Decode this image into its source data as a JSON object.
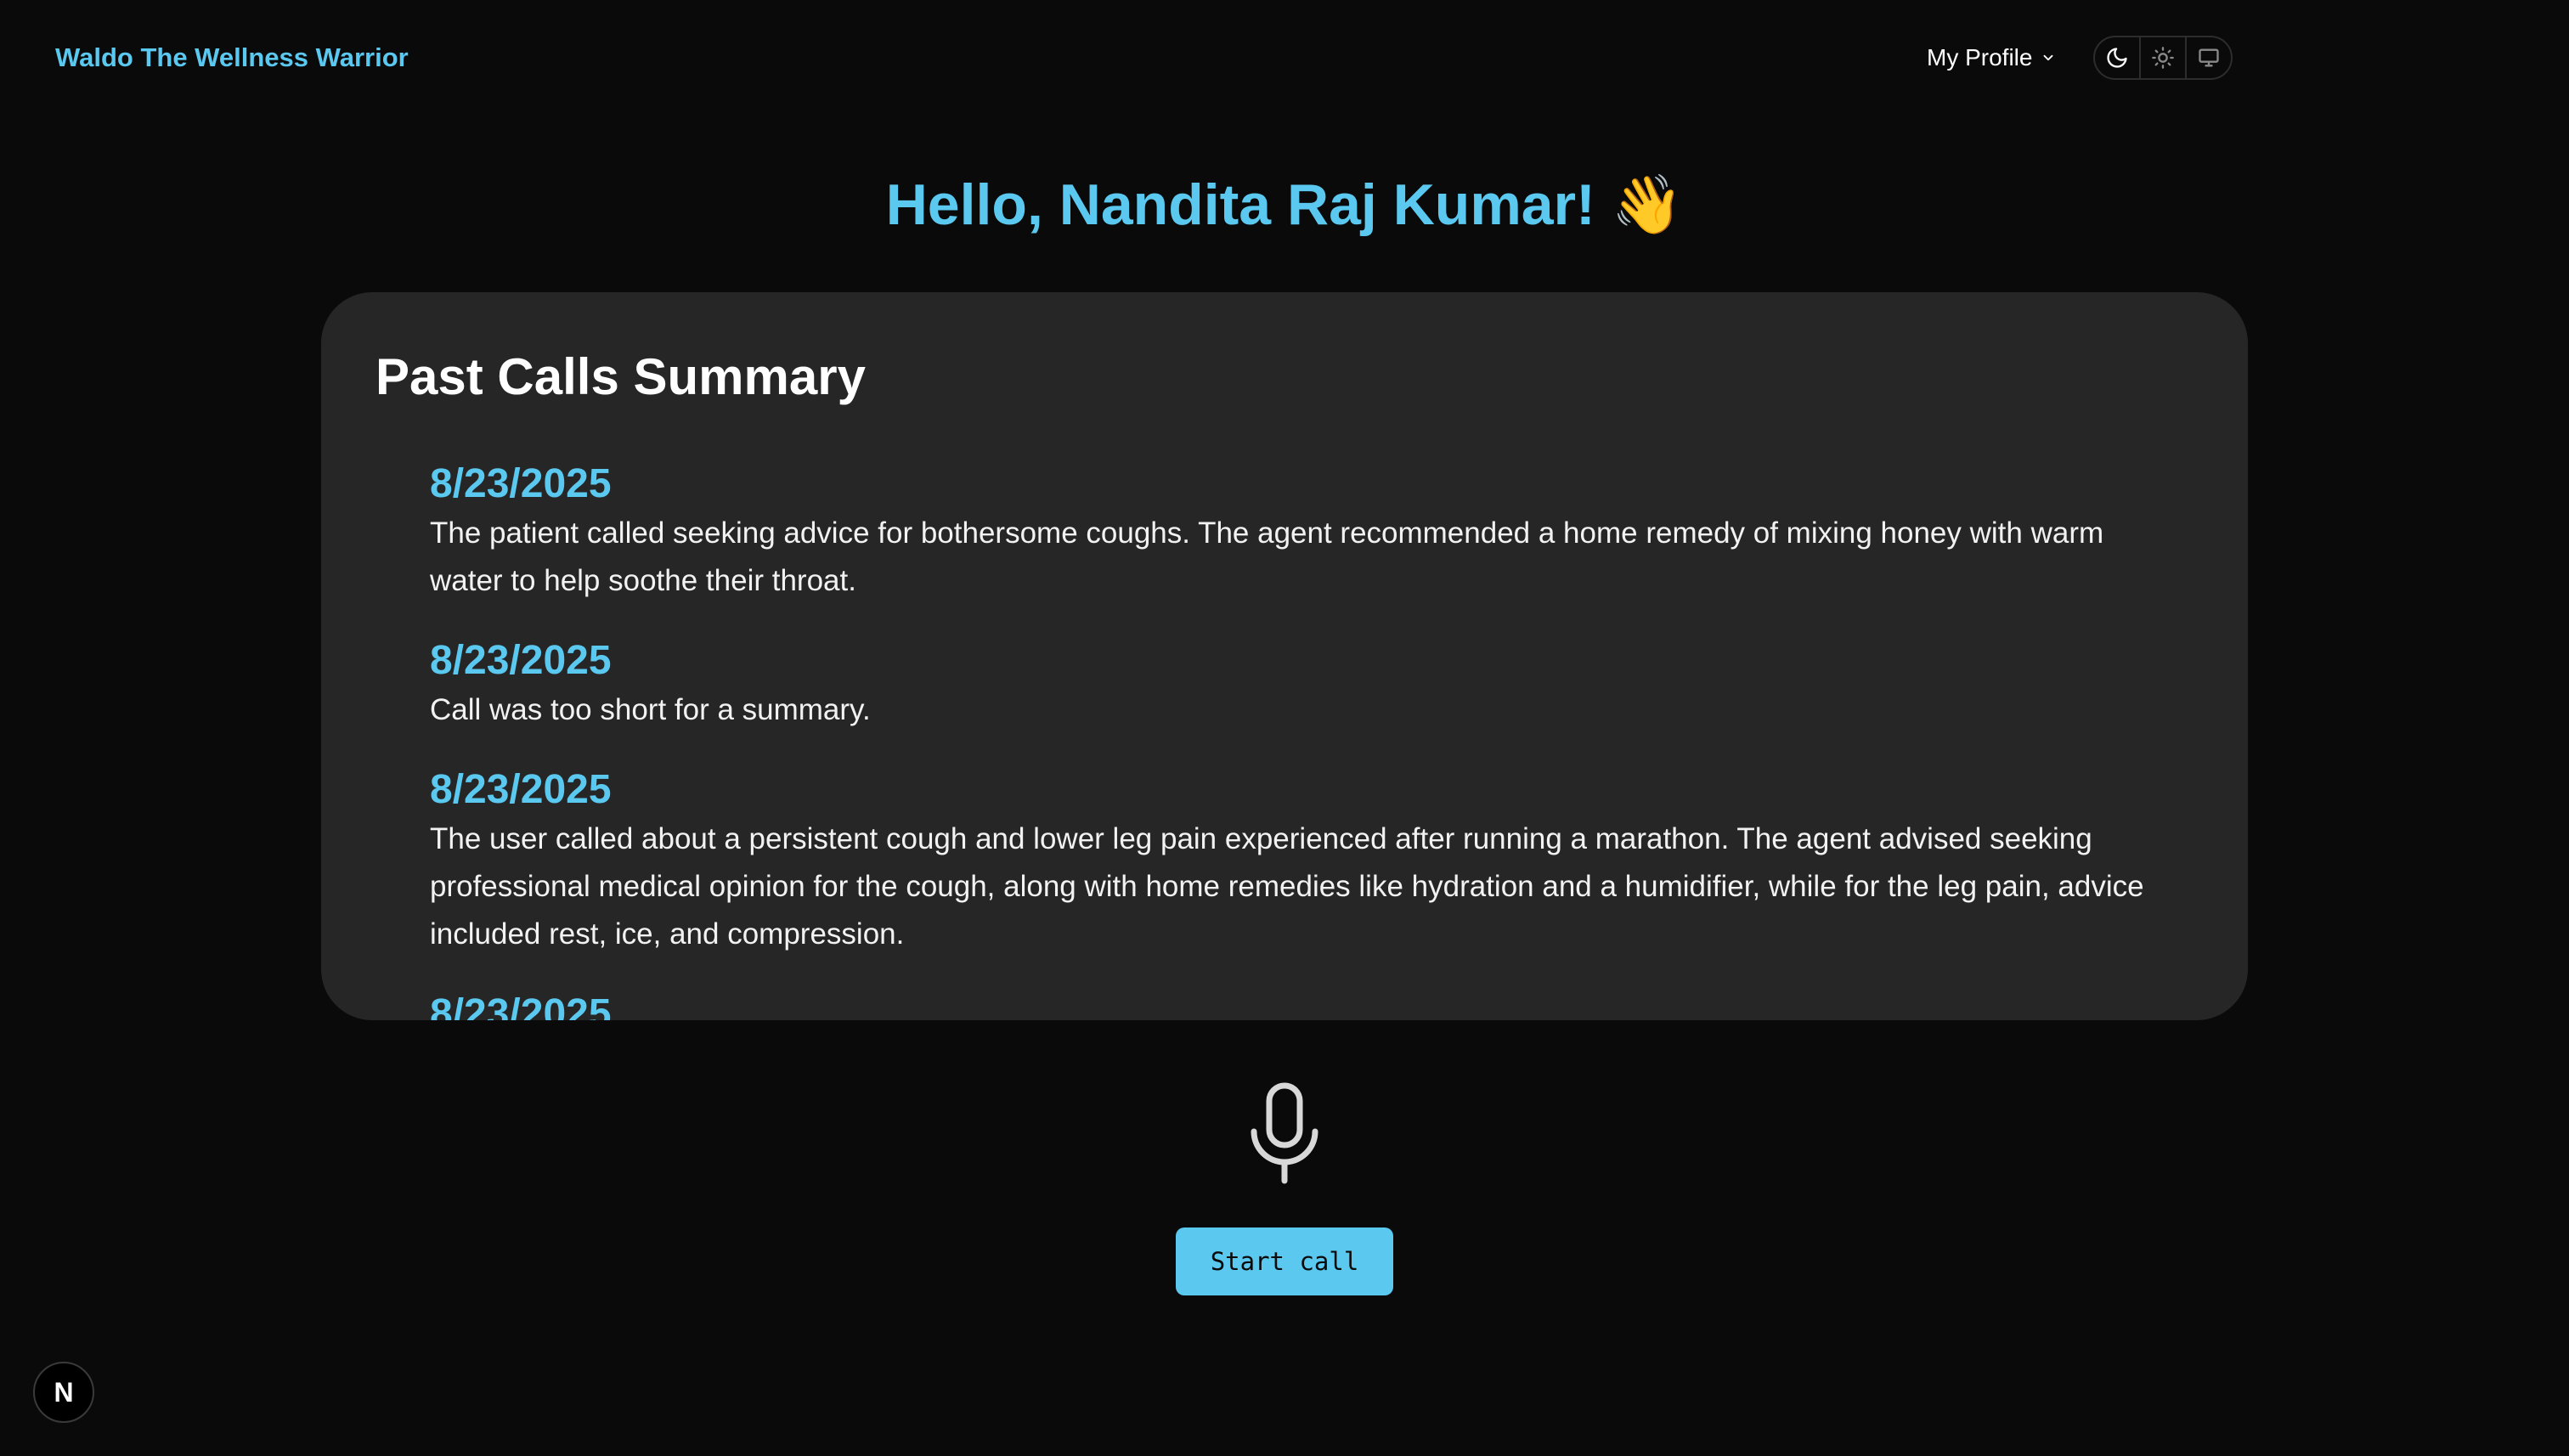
{
  "header": {
    "brand": "Waldo The Wellness Warrior",
    "profile_label": "My Profile",
    "theme_options": [
      "dark",
      "light",
      "system"
    ]
  },
  "greeting": {
    "text": "Hello, Nandita Raj Kumar! 👋"
  },
  "past_calls": {
    "title": "Past Calls Summary",
    "items": [
      {
        "date": "8/23/2025",
        "summary": "The patient called seeking advice for bothersome coughs. The agent recommended a home remedy of mixing honey with warm water to help soothe their throat."
      },
      {
        "date": "8/23/2025",
        "summary": "Call was too short for a summary."
      },
      {
        "date": "8/23/2025",
        "summary": "The user called about a persistent cough and lower leg pain experienced after running a marathon. The agent advised seeking professional medical opinion for the cough, along with home remedies like hydration and a humidifier, while for the leg pain, advice included rest, ice, and compression."
      },
      {
        "date": "8/23/2025",
        "summary": ""
      }
    ]
  },
  "call_controls": {
    "mic_icon": "microphone-icon",
    "start_label": "Start call"
  },
  "dev_badge": {
    "label": "N"
  },
  "colors": {
    "accent": "#5ac8ef",
    "background": "#0a0a0a",
    "card": "#262626"
  }
}
